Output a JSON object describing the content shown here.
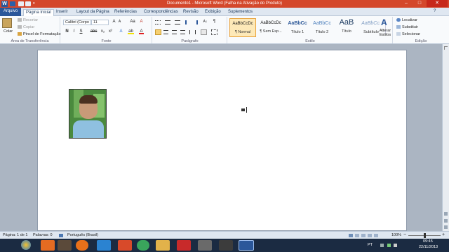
{
  "titlebar": {
    "title": "Documento1 - Microsoft Word (Falha na Ativação do Produto)",
    "minimize": "–",
    "maximize": "□",
    "close": "✕",
    "qa_more": "▾"
  },
  "tabs": {
    "file": "Arquivo",
    "items": [
      "Página Inicial",
      "Inserir",
      "Layout da Página",
      "Referências",
      "Correspondências",
      "Revisão",
      "Exibição",
      "Suplementos"
    ]
  },
  "ribbon": {
    "clipboard": {
      "paste": "Colar",
      "cut": "Recortar",
      "copy": "Copiar",
      "format_painter": "Pincel de Formatação",
      "label": "Área de Transferência"
    },
    "font": {
      "name": "Calibri (Corpo",
      "size": "11",
      "grow": "A",
      "shrink": "A",
      "case": "Aa",
      "clear": "A",
      "bold": "N",
      "italic": "I",
      "underline": "S",
      "strike": "abc",
      "subscript": "x₂",
      "superscript": "x²",
      "effects": "A",
      "highlight": "ab",
      "color": "A",
      "label": "Fonte"
    },
    "paragraph": {
      "label": "Parágrafo",
      "sort": "A↓",
      "pilcrow": "¶"
    },
    "styles": {
      "items": [
        {
          "preview": "AaBbCcDc",
          "name": "¶ Normal"
        },
        {
          "preview": "AaBbCcDc",
          "name": "¶ Sem Esp..."
        },
        {
          "preview": "AaBbCc",
          "name": "Título 1"
        },
        {
          "preview": "AaBbCc",
          "name": "Título 2"
        },
        {
          "preview": "AaB",
          "name": "Título"
        },
        {
          "preview": "AaBbCc.",
          "name": "Subtítulo"
        }
      ],
      "change": "Alterar Estilos",
      "label": "Estilo"
    },
    "editing": {
      "find": "Localizar",
      "replace": "Substituir",
      "select": "Selecionar",
      "label": "Edição"
    }
  },
  "statusbar": {
    "page": "Página: 1 de 1",
    "words": "Palavras: 0",
    "language": "Português (Brasil)",
    "zoom": "100%",
    "zoom_minus": "−",
    "zoom_plus": "+",
    "zoom_level": 1.0
  },
  "taskbar": {
    "lang": "PT",
    "time": "09:45",
    "date": "22/11/2013"
  },
  "colors": {
    "titlebar": "#d4472b",
    "file_tab": "#2b579a",
    "ribbon_bg": "#f8fafc",
    "doc_bg": "#abb5c2",
    "taskbar": "#1b2b42"
  }
}
